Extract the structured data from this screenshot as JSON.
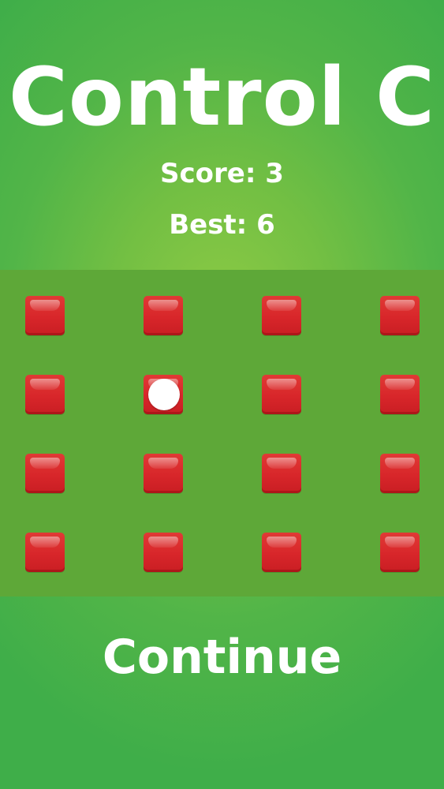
{
  "title": "Control C",
  "score_text": "Score: 3",
  "best_text": "Best: 6",
  "continue_label": "Continue",
  "colors": {
    "background": "#52b548",
    "board": "#5ea838",
    "tile": "#d8262a",
    "ball": "#ffffff",
    "text": "#ffffff"
  },
  "grid": {
    "rows": 4,
    "cols": 4,
    "ball_cell": {
      "row": 2,
      "col": 2
    }
  }
}
